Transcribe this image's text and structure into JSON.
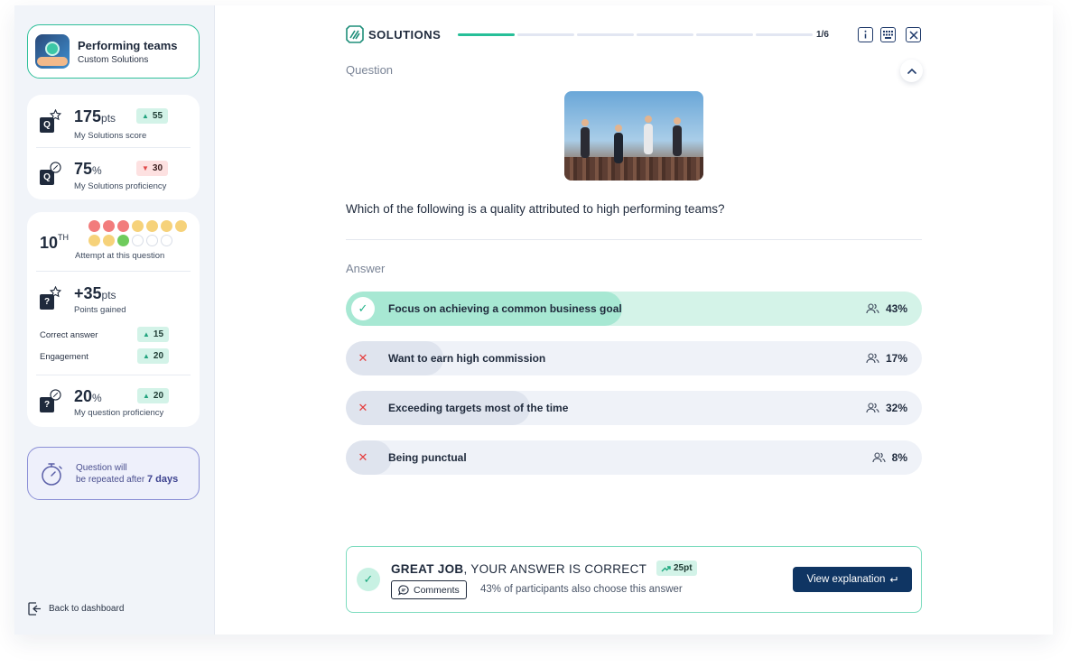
{
  "sidebar": {
    "team": {
      "title": "Performing teams",
      "subtitle": "Custom Solutions"
    },
    "score": {
      "value": "175",
      "unit": "pts",
      "label": "My Solutions score",
      "delta": "55",
      "delta_direction": "up"
    },
    "proficiency": {
      "value": "75",
      "unit": "%",
      "label": "My Solutions proficiency",
      "delta": "30",
      "delta_direction": "down"
    },
    "attempt": {
      "rank": "10",
      "rank_suffix": "TH",
      "label": "Attempt at this question",
      "dots": [
        "red",
        "red",
        "red",
        "yellow",
        "yellow",
        "yellow",
        "yellow",
        "yellow",
        "yellow",
        "green",
        "empty",
        "empty",
        "empty"
      ]
    },
    "points_gained": {
      "value": "+35",
      "unit": "pts",
      "label": "Points gained"
    },
    "breakdown": [
      {
        "label": "Correct answer",
        "delta": "15"
      },
      {
        "label": "Engagement",
        "delta": "20"
      }
    ],
    "question_proficiency": {
      "value": "20",
      "unit": "%",
      "label": "My question proficiency",
      "delta": "20"
    },
    "repeat": {
      "line1": "Question will",
      "line2": "be repeated after",
      "emphasis": "7 days"
    },
    "back_label": "Back to dashboard"
  },
  "header": {
    "brand": "SOLUTIONS",
    "progress_current": 1,
    "progress_total": 6,
    "counter": "1/6",
    "accent": "#27bf98"
  },
  "question": {
    "section_label": "Question",
    "text": "Which of the following is a quality attributed to high performing teams?"
  },
  "answers": {
    "section_label": "Answer",
    "items": [
      {
        "text": "Focus on achieving a common business goal",
        "percent": "43%",
        "fill": 0.48,
        "correct": true
      },
      {
        "text": "Want to earn high commission",
        "percent": "17%",
        "fill": 0.17,
        "correct": false
      },
      {
        "text": "Exceeding targets most of the time",
        "percent": "32%",
        "fill": 0.32,
        "correct": false
      },
      {
        "text": "Being punctual",
        "percent": "8%",
        "fill": 0.08,
        "correct": false
      }
    ]
  },
  "result": {
    "headline_bold": "GREAT JOB",
    "headline_rest": ", YOUR ANSWER IS CORRECT",
    "points": "25pt",
    "comments_label": "Comments",
    "share_text": "43% of participants also choose this answer",
    "explain_label": "View explanation"
  },
  "icons": {
    "logo": "solutions-logo-icon",
    "info": "info-icon",
    "keyboard": "keyboard-icon",
    "close": "close-icon",
    "collapse": "chevron-up-icon",
    "participants": "users-icon",
    "check": "check-icon",
    "cross": "cross-icon",
    "timer": "stopwatch-icon",
    "back": "logout-icon",
    "trend": "trend-up-icon",
    "comment": "comment-icon",
    "enter": "enter-key-icon"
  }
}
